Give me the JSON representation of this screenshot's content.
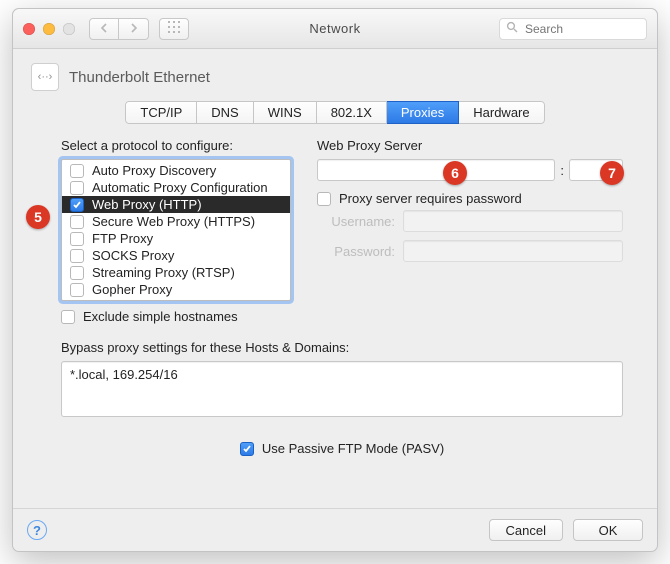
{
  "window": {
    "title": "Network",
    "search_placeholder": "Search"
  },
  "connection": {
    "icon_glyph": "‹··›",
    "name": "Thunderbolt Ethernet"
  },
  "tabs": [
    {
      "label": "TCP/IP",
      "active": false
    },
    {
      "label": "DNS",
      "active": false
    },
    {
      "label": "WINS",
      "active": false
    },
    {
      "label": "802.1X",
      "active": false
    },
    {
      "label": "Proxies",
      "active": true
    },
    {
      "label": "Hardware",
      "active": false
    }
  ],
  "labels": {
    "select_protocol": "Select a protocol to configure:",
    "web_proxy_server": "Web Proxy Server",
    "requires_password": "Proxy server requires password",
    "username": "Username:",
    "password": "Password:",
    "exclude_simple": "Exclude simple hostnames",
    "bypass": "Bypass proxy settings for these Hosts & Domains:",
    "passive_ftp": "Use Passive FTP Mode (PASV)",
    "cancel": "Cancel",
    "ok": "OK",
    "colon": ":"
  },
  "protocols": [
    {
      "label": "Auto Proxy Discovery",
      "checked": false,
      "selected": false
    },
    {
      "label": "Automatic Proxy Configuration",
      "checked": false,
      "selected": false
    },
    {
      "label": "Web Proxy (HTTP)",
      "checked": true,
      "selected": true
    },
    {
      "label": "Secure Web Proxy (HTTPS)",
      "checked": false,
      "selected": false
    },
    {
      "label": "FTP Proxy",
      "checked": false,
      "selected": false
    },
    {
      "label": "SOCKS Proxy",
      "checked": false,
      "selected": false
    },
    {
      "label": "Streaming Proxy (RTSP)",
      "checked": false,
      "selected": false
    },
    {
      "label": "Gopher Proxy",
      "checked": false,
      "selected": false
    }
  ],
  "proxy_server": {
    "host": "",
    "port": ""
  },
  "requires_password_checked": false,
  "credentials": {
    "username": "",
    "password": ""
  },
  "exclude_simple_checked": false,
  "bypass_value": "*.local, 169.254/16",
  "passive_ftp_checked": true,
  "callouts": {
    "five": "5",
    "six": "6",
    "seven": "7"
  },
  "colors": {
    "accent": "#3a82ea",
    "badge": "#db3725"
  }
}
